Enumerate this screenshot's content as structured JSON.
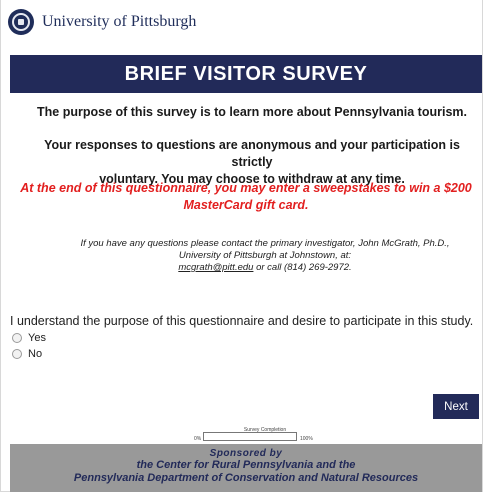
{
  "header": {
    "university_name": "University of Pittsburgh"
  },
  "survey": {
    "title": "BRIEF VISITOR SURVEY",
    "intro": "The purpose of this survey is to learn more about Pennsylvania tourism.",
    "anonymity_line1": "Your responses to questions are anonymous and your participation is strictly",
    "anonymity_line2": "voluntary. You may choose to withdraw at any time.",
    "sweepstakes_line1": "At the end of this questionnaire, you may enter a sweepstakes to win a $200",
    "sweepstakes_line2": "MasterCard gift card.",
    "contact_line1": "If you have any questions please contact the primary investigator, John McGrath, Ph.D.,",
    "contact_line2": "University of Pittsburgh at Johnstown, at:",
    "contact_email": "mcgrath@pitt.edu",
    "contact_phone": " or call (814) 269-2972.",
    "question": "I understand the purpose of this questionnaire and desire to participate in this study.",
    "options": [
      {
        "label": "Yes"
      },
      {
        "label": "No"
      }
    ],
    "next_label": "Next"
  },
  "progress": {
    "label": "Survey Completion",
    "min_label": "0%",
    "max_label": "100%",
    "value": 0
  },
  "footer": {
    "sponsored": "Sponsored by",
    "line1": "the Center for Rural Pennsylvania and the",
    "line2": "Pennsylvania Department of Conservation and Natural Resources"
  },
  "colors": {
    "navy": "#222a59",
    "alert_red": "#e21f1f",
    "footer_gray": "#999999"
  }
}
